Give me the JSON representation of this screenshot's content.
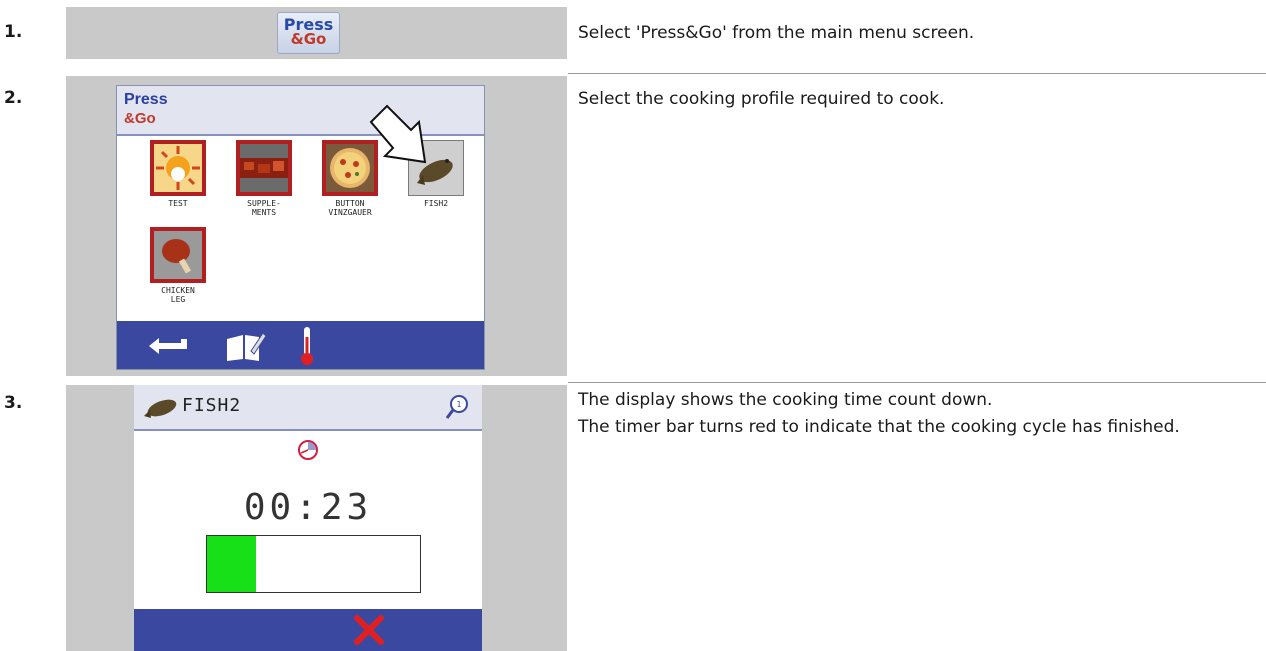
{
  "steps": [
    {
      "number": "1.",
      "text": "Select 'Press&Go' from the main menu screen."
    },
    {
      "number": "2.",
      "text": "Select the cooking profile required to cook."
    },
    {
      "number": "3.",
      "lines": [
        "The display shows the cooking time count down.",
        "The timer bar turns red to indicate that the cooking cycle has finished."
      ]
    }
  ],
  "logo": {
    "line1": "Press",
    "line2": "&Go"
  },
  "screen2": {
    "logo_line1": "Press",
    "logo_line2": "&Go",
    "profiles": [
      {
        "label": "TEST",
        "icon": "sun-chef-icon"
      },
      {
        "label": "SUPPLE-\nMENTS",
        "icon": "supplements-icon"
      },
      {
        "label": "BUTTON\nVINZGAUER",
        "icon": "pizza-icon"
      },
      {
        "label": "FISH2",
        "icon": "fish-icon"
      },
      {
        "label": "CHICKEN\nLEG",
        "icon": "chicken-leg-icon"
      }
    ],
    "footer_icons": [
      "back-arrow-icon",
      "book-edit-icon",
      "thermometer-icon"
    ]
  },
  "screen3": {
    "title": "FISH2",
    "timer": "00:23",
    "progress": 0.23,
    "colors": {
      "progress": "#18e018",
      "footer": "#3b48a0",
      "cancel": "#e02020"
    }
  }
}
